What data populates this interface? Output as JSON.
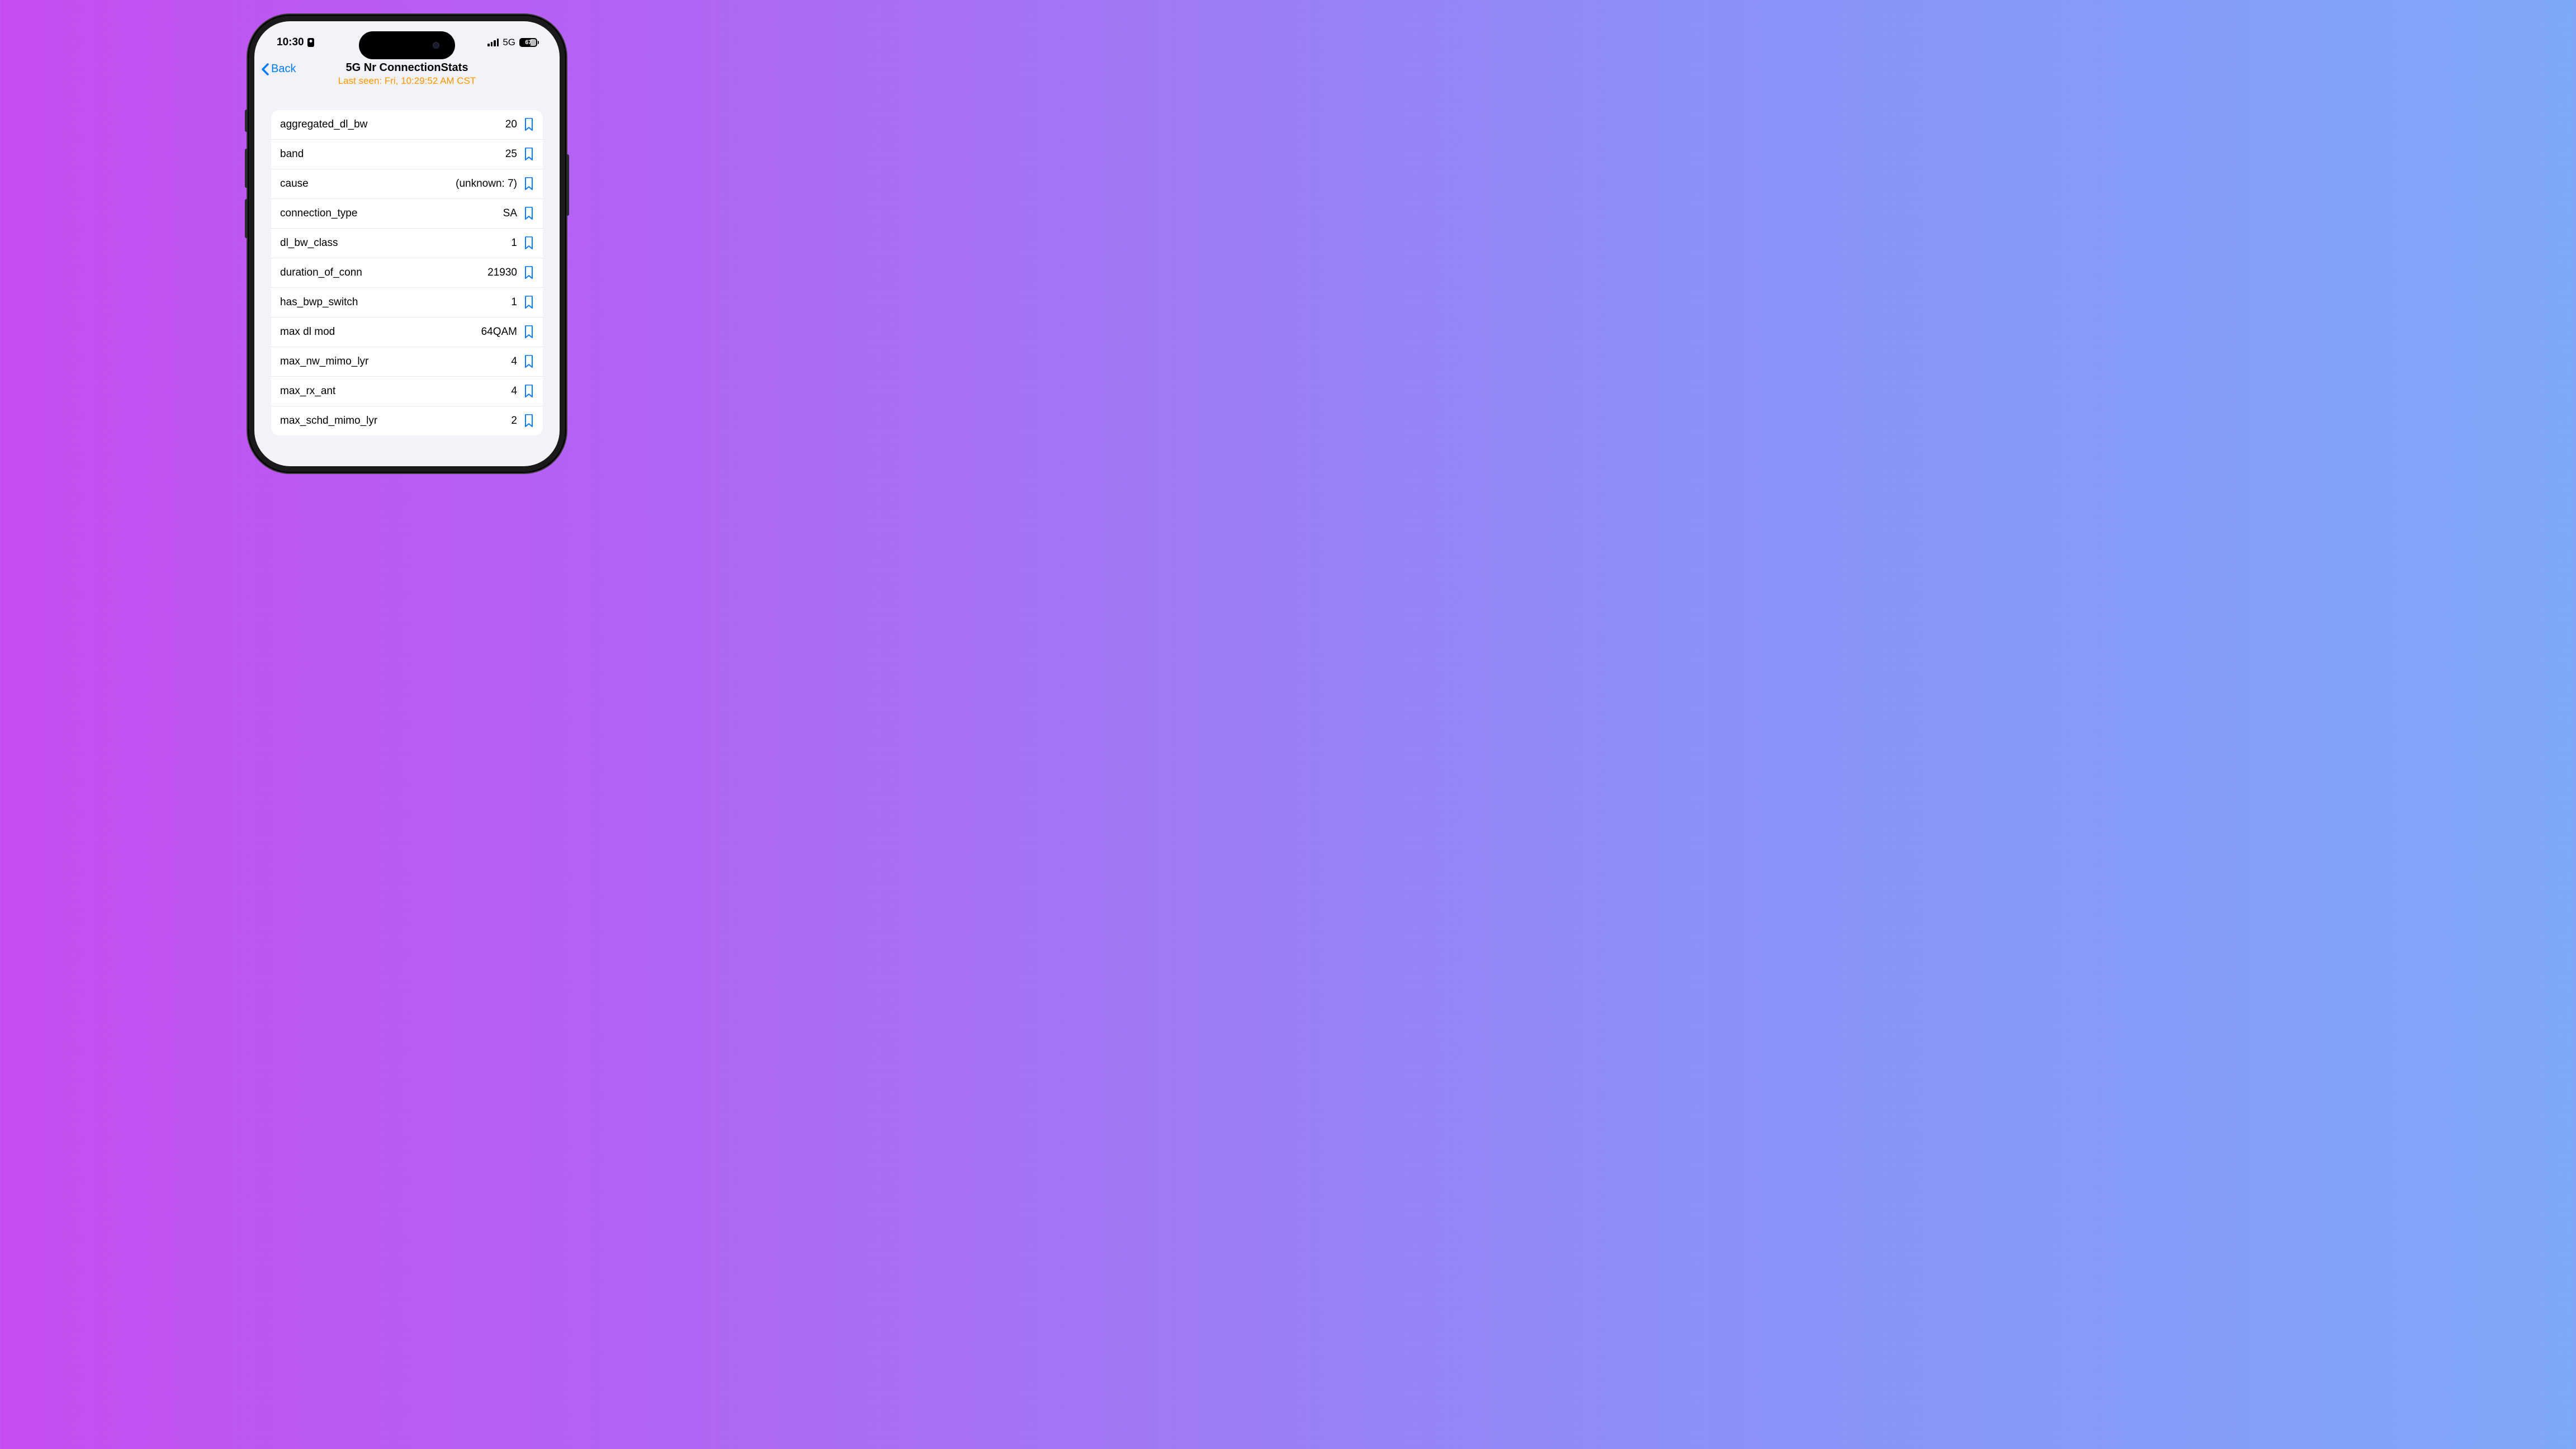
{
  "status_bar": {
    "time": "10:30",
    "network": "5G",
    "battery": "67"
  },
  "nav": {
    "back_label": "Back",
    "title": "5G Nr ConnectionStats",
    "subtitle": "Last seen: Fri, 10:29:52 AM CST"
  },
  "stats": [
    {
      "label": "aggregated_dl_bw",
      "value": "20"
    },
    {
      "label": "band",
      "value": "25"
    },
    {
      "label": "cause",
      "value": "(unknown: 7)"
    },
    {
      "label": "connection_type",
      "value": "SA"
    },
    {
      "label": "dl_bw_class",
      "value": "1"
    },
    {
      "label": "duration_of_conn",
      "value": "21930"
    },
    {
      "label": "has_bwp_switch",
      "value": "1"
    },
    {
      "label": "max dl mod",
      "value": "64QAM"
    },
    {
      "label": "max_nw_mimo_lyr",
      "value": "4"
    },
    {
      "label": "max_rx_ant",
      "value": "4"
    },
    {
      "label": "max_schd_mimo_lyr",
      "value": "2"
    }
  ]
}
